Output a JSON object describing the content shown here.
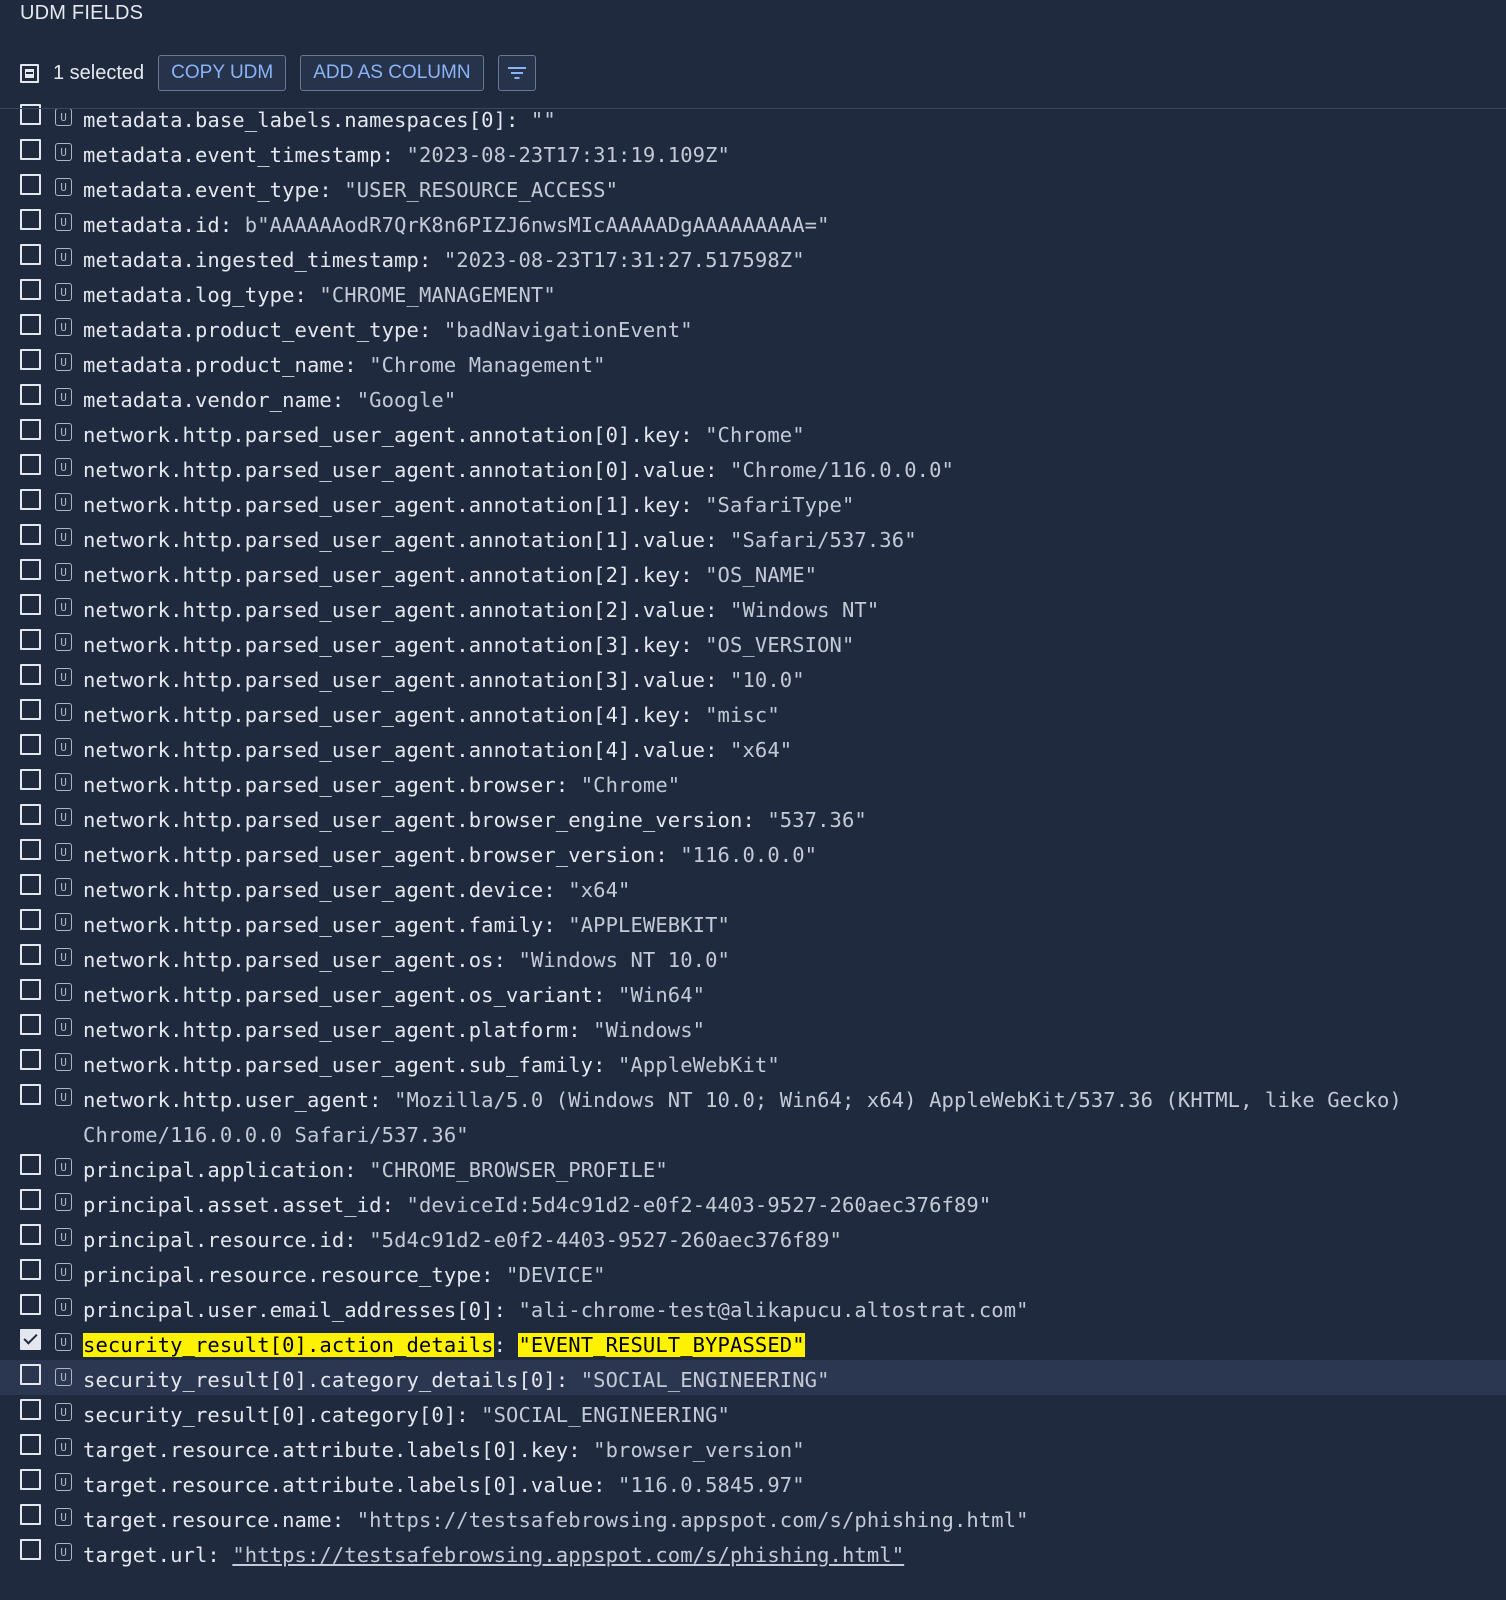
{
  "header": {
    "title": "UDM FIELDS",
    "selected_text": "1 selected",
    "copy_button": "COPY UDM",
    "add_column_button": "ADD AS COLUMN",
    "filter_icon": "filter-icon"
  },
  "fields": [
    {
      "key": "metadata.base_labels.namespaces[0]",
      "value": "\"\""
    },
    {
      "key": "metadata.event_timestamp",
      "value": "\"2023-08-23T17:31:19.109Z\""
    },
    {
      "key": "metadata.event_type",
      "value": "\"USER_RESOURCE_ACCESS\""
    },
    {
      "key": "metadata.id",
      "value": "b\"AAAAAAodR7QrK8n6PIZJ6nwsMIcAAAAADgAAAAAAAAA=\""
    },
    {
      "key": "metadata.ingested_timestamp",
      "value": "\"2023-08-23T17:31:27.517598Z\""
    },
    {
      "key": "metadata.log_type",
      "value": "\"CHROME_MANAGEMENT\""
    },
    {
      "key": "metadata.product_event_type",
      "value": "\"badNavigationEvent\""
    },
    {
      "key": "metadata.product_name",
      "value": "\"Chrome Management\""
    },
    {
      "key": "metadata.vendor_name",
      "value": "\"Google\""
    },
    {
      "key": "network.http.parsed_user_agent.annotation[0].key",
      "value": "\"Chrome\""
    },
    {
      "key": "network.http.parsed_user_agent.annotation[0].value",
      "value": "\"Chrome/116.0.0.0\""
    },
    {
      "key": "network.http.parsed_user_agent.annotation[1].key",
      "value": "\"SafariType\""
    },
    {
      "key": "network.http.parsed_user_agent.annotation[1].value",
      "value": "\"Safari/537.36\""
    },
    {
      "key": "network.http.parsed_user_agent.annotation[2].key",
      "value": "\"OS_NAME\""
    },
    {
      "key": "network.http.parsed_user_agent.annotation[2].value",
      "value": "\"Windows NT\""
    },
    {
      "key": "network.http.parsed_user_agent.annotation[3].key",
      "value": "\"OS_VERSION\""
    },
    {
      "key": "network.http.parsed_user_agent.annotation[3].value",
      "value": "\"10.0\""
    },
    {
      "key": "network.http.parsed_user_agent.annotation[4].key",
      "value": "\"misc\""
    },
    {
      "key": "network.http.parsed_user_agent.annotation[4].value",
      "value": "\"x64\""
    },
    {
      "key": "network.http.parsed_user_agent.browser",
      "value": "\"Chrome\""
    },
    {
      "key": "network.http.parsed_user_agent.browser_engine_version",
      "value": "\"537.36\""
    },
    {
      "key": "network.http.parsed_user_agent.browser_version",
      "value": "\"116.0.0.0\""
    },
    {
      "key": "network.http.parsed_user_agent.device",
      "value": "\"x64\""
    },
    {
      "key": "network.http.parsed_user_agent.family",
      "value": "\"APPLEWEBKIT\""
    },
    {
      "key": "network.http.parsed_user_agent.os",
      "value": "\"Windows NT 10.0\""
    },
    {
      "key": "network.http.parsed_user_agent.os_variant",
      "value": "\"Win64\""
    },
    {
      "key": "network.http.parsed_user_agent.platform",
      "value": "\"Windows\""
    },
    {
      "key": "network.http.parsed_user_agent.sub_family",
      "value": "\"AppleWebKit\""
    },
    {
      "key": "network.http.user_agent",
      "value": "\"Mozilla/5.0 (Windows NT 10.0; Win64; x64) AppleWebKit/537.36 (KHTML, like Gecko) Chrome/116.0.0.0 Safari/537.36\"",
      "tall": true
    },
    {
      "key": "principal.application",
      "value": "\"CHROME_BROWSER_PROFILE\""
    },
    {
      "key": "principal.asset.asset_id",
      "value": "\"deviceId:5d4c91d2-e0f2-4403-9527-260aec376f89\""
    },
    {
      "key": "principal.resource.id",
      "value": "\"5d4c91d2-e0f2-4403-9527-260aec376f89\""
    },
    {
      "key": "principal.resource.resource_type",
      "value": "\"DEVICE\""
    },
    {
      "key": "principal.user.email_addresses[0]",
      "value": "\"ali-chrome-test@alikapucu.altostrat.com\""
    },
    {
      "key": "security_result[0].action_details",
      "value": "\"EVENT_RESULT_BYPASSED\"",
      "checked": true,
      "highlighted": true
    },
    {
      "key": "security_result[0].category_details[0]",
      "value": "\"SOCIAL_ENGINEERING\"",
      "hover": true
    },
    {
      "key": "security_result[0].category[0]",
      "value": "\"SOCIAL_ENGINEERING\""
    },
    {
      "key": "target.resource.attribute.labels[0].key",
      "value": "\"browser_version\""
    },
    {
      "key": "target.resource.attribute.labels[0].value",
      "value": "\"116.0.5845.97\""
    },
    {
      "key": "target.resource.name",
      "value": "\"https://testsafebrowsing.appspot.com/s/phishing.html\""
    },
    {
      "key": "target.url",
      "value": "\"https://testsafebrowsing.appspot.com/s/phishing.html\"",
      "link": true
    }
  ],
  "field_type_badge": "U",
  "separator": ": ",
  "colors": {
    "background": "#1f2a3e",
    "accent": "#8ab4f8",
    "highlight": "#fff200",
    "hover_row": "#2b3750"
  }
}
